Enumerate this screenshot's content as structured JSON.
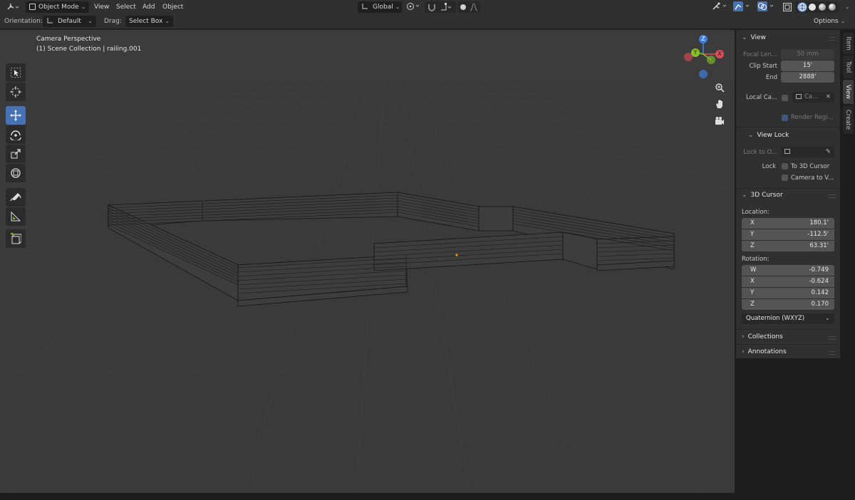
{
  "header": {
    "editor_type_icon": "3d-viewport-icon",
    "mode": "Object Mode",
    "menus": [
      "View",
      "Select",
      "Add",
      "Object"
    ],
    "transform_orientation": "Global"
  },
  "tool_settings": {
    "orientation_label": "Orientation:",
    "orientation_value": "Default",
    "drag_label": "Drag:",
    "drag_value": "Select Box",
    "options_label": "Options"
  },
  "viewport": {
    "view_name": "Camera Perspective",
    "collection_info": "(1) Scene Collection | railing.001",
    "gizmo_axes": {
      "x": "X",
      "y": "Y",
      "z": "Z"
    },
    "colors": {
      "x_axis": "#e04b57",
      "y_axis": "#8bbf2a",
      "z_axis": "#3d7ee0",
      "origin": "#f0a000"
    }
  },
  "toolbar": {
    "tools": [
      "select-box-icon",
      "cursor-icon",
      "move-icon",
      "rotate-icon",
      "scale-icon",
      "transform-icon",
      "annotate-icon",
      "measure-icon",
      "add-cube-icon"
    ],
    "active": "move-icon"
  },
  "sidebar": {
    "tabs": [
      "Item",
      "Tool",
      "View",
      "Create"
    ],
    "active_tab": "View",
    "view_panel": {
      "title": "View",
      "focal_length_label": "Focal Len...",
      "focal_length_value": "50 mm",
      "clip_start_label": "Clip Start",
      "clip_start_value": "15'",
      "clip_end_label": "End",
      "clip_end_value": "2888'",
      "local_camera_label": "Local Ca...",
      "local_camera_value": "Ca...",
      "render_region_label": "Render Regi..."
    },
    "view_lock": {
      "title": "View Lock",
      "lock_to_object_label": "Lock to O...",
      "lock_label": "Lock",
      "to_3d_cursor_label": "To 3D Cursor",
      "camera_to_view_label": "Camera to V..."
    },
    "cursor_panel": {
      "title": "3D Cursor",
      "location_label": "Location:",
      "location": [
        {
          "axis": "X",
          "value": "180.1'"
        },
        {
          "axis": "Y",
          "value": "-112.5'"
        },
        {
          "axis": "Z",
          "value": "63.31'"
        }
      ],
      "rotation_label": "Rotation:",
      "rotation": [
        {
          "axis": "W",
          "value": "-0.749"
        },
        {
          "axis": "X",
          "value": "-0.624"
        },
        {
          "axis": "Y",
          "value": "0.142"
        },
        {
          "axis": "Z",
          "value": "0.170"
        }
      ],
      "rotation_mode": "Quaternion (WXYZ)"
    },
    "collapsed_panels": [
      "Collections",
      "Annotations"
    ]
  }
}
